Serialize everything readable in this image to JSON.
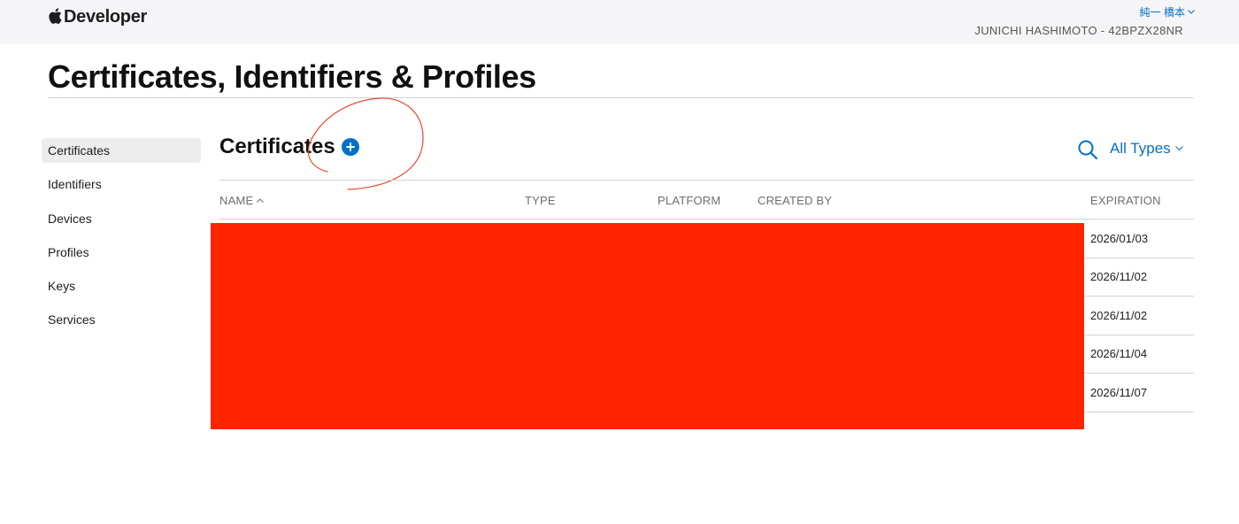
{
  "header": {
    "brand": "Developer",
    "user_name": "純一 橋本",
    "team": "JUNICHI HASHIMOTO - 42BPZX28NR"
  },
  "page": {
    "title": "Certificates, Identifiers & Profiles"
  },
  "sidebar": {
    "items": [
      {
        "label": "Certificates",
        "active": true
      },
      {
        "label": "Identifiers"
      },
      {
        "label": "Devices"
      },
      {
        "label": "Profiles"
      },
      {
        "label": "Keys"
      },
      {
        "label": "Services"
      }
    ]
  },
  "main": {
    "section_title": "Certificates",
    "filter_label": "All Types",
    "columns": [
      "NAME",
      "TYPE",
      "PLATFORM",
      "CREATED BY",
      "EXPIRATION"
    ],
    "rows": [
      {
        "expiration": "2026/01/03"
      },
      {
        "expiration": "2026/11/02"
      },
      {
        "expiration": "2026/11/02"
      },
      {
        "expiration": "2026/11/04"
      },
      {
        "expiration": "2026/11/07"
      }
    ]
  },
  "colors": {
    "accent": "#0070c9",
    "annotation": "#e8492a",
    "redaction": "#ff2400"
  },
  "icons": [
    "apple-logo-icon",
    "chevron-down-icon",
    "plus-circle-icon",
    "search-icon",
    "sort-ascending-icon"
  ]
}
